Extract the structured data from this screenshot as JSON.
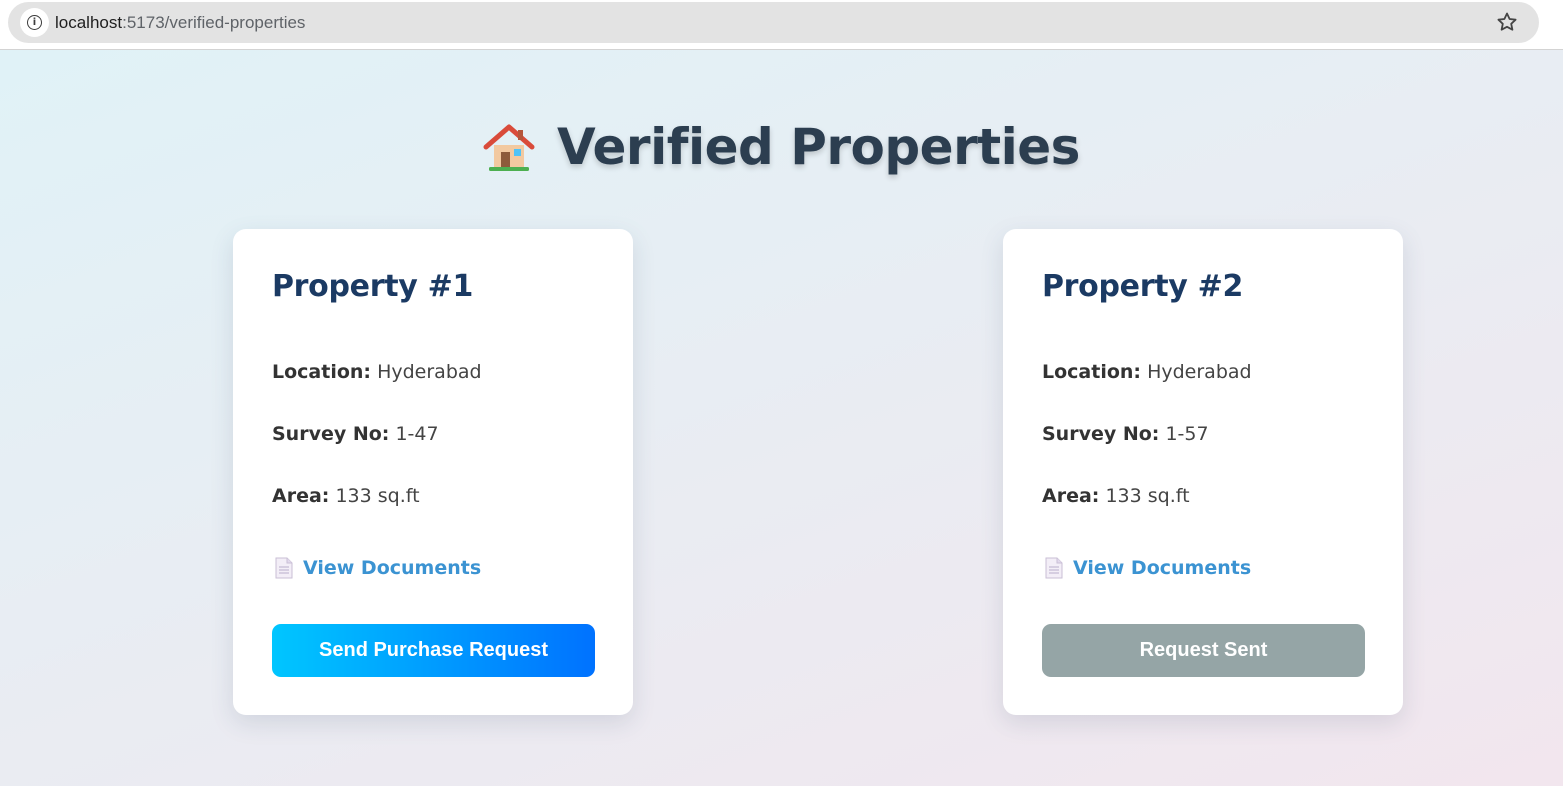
{
  "browser": {
    "url_host": "localhost",
    "url_rest": ":5173/verified-properties",
    "info_icon": "info-icon",
    "bookmark_icon": "star-icon"
  },
  "page": {
    "title": "Verified Properties",
    "title_icon": "house-icon"
  },
  "properties": [
    {
      "title": "Property #1",
      "location_label": "Location:",
      "location": "Hyderabad",
      "survey_label": "Survey No:",
      "survey_no": "1-47",
      "area_label": "Area:",
      "area": "133 sq.ft",
      "docs_label": "View Documents",
      "button_label": "Send Purchase Request",
      "button_state": "active"
    },
    {
      "title": "Property #2",
      "location_label": "Location:",
      "location": "Hyderabad",
      "survey_label": "Survey No:",
      "survey_no": "1-57",
      "area_label": "Area:",
      "area": "133 sq.ft",
      "docs_label": "View Documents",
      "button_label": "Request Sent",
      "button_state": "sent"
    }
  ],
  "colors": {
    "title": "#2c3e50",
    "card_title": "#1b3a63",
    "link": "#3b93d2",
    "button_gradient_start": "#00c6ff",
    "button_gradient_end": "#0072ff",
    "button_sent": "#95a5a6"
  }
}
